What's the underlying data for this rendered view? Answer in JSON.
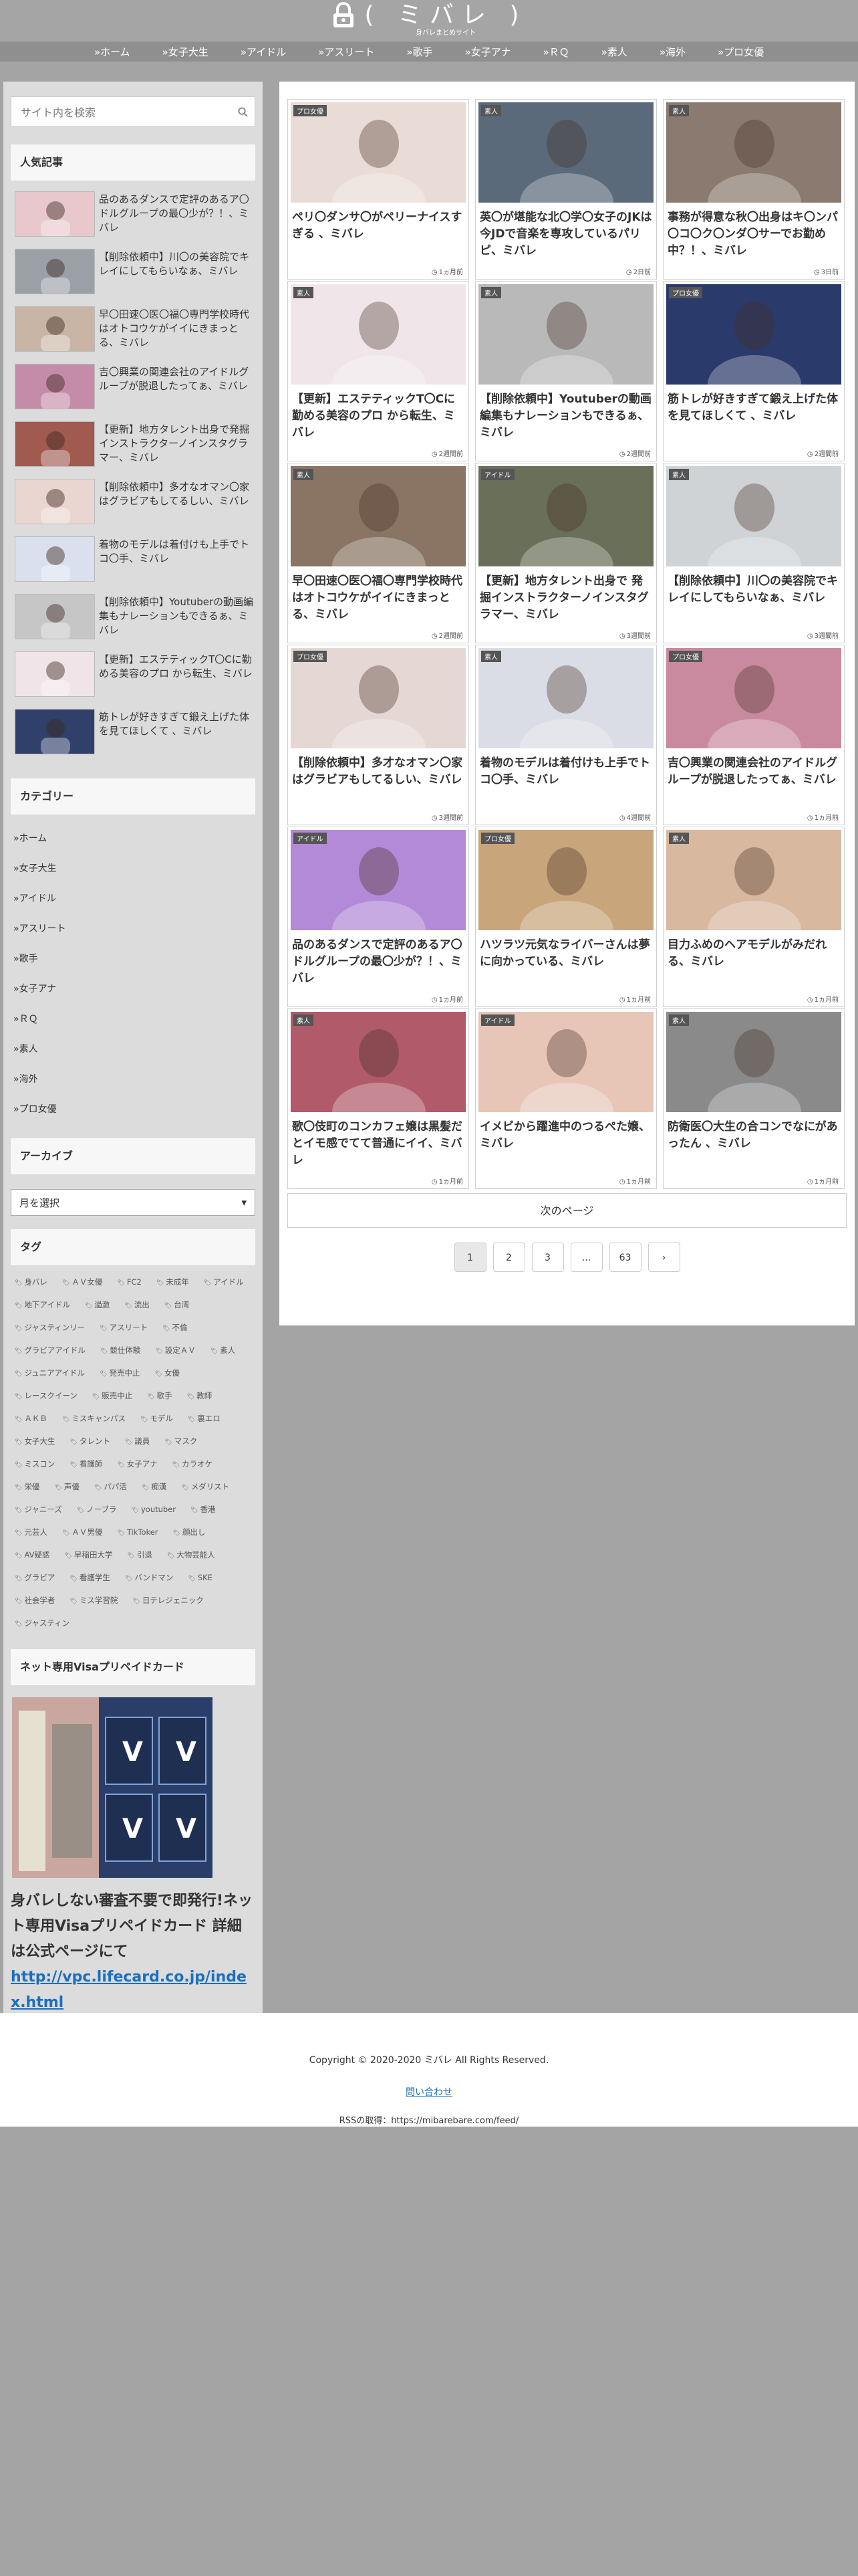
{
  "header": {
    "logo_text": "( ミバレ )",
    "logo_tagline": "身バレまとめサイト"
  },
  "nav": [
    "»ホーム",
    "»女子大生",
    "»アイドル",
    "»アスリート",
    "»歌手",
    "»女子アナ",
    "»ＲＱ",
    "»素人",
    "»海外",
    "»プロ女優"
  ],
  "sidebar": {
    "search_placeholder": "サイト内を検索",
    "popular_title": "人気記事",
    "popular": [
      "品のあるダンスで定評のあるア〇ドルグループの最〇少が？！、ミバレ",
      "【削除依頼中】川〇の美容院でキレイにしてもらいなぁ、ミバレ",
      "早〇田速〇医〇福〇専門学校時代はオトコウケがイイにきまっとる、ミバレ",
      "吉〇興業の関連会社のアイドルグループが脱退したってぁ、ミバレ",
      "【更新】地方タレント出身で発掘インストラクターノインスタグラマー、ミバレ",
      "【削除依頼中】多才なオマン〇家はグラビアもしてるしい、ミバレ",
      "着物のモデルは着付けも上手でトコ〇手、ミバレ",
      "【削除依頼中】Youtuberの動画編集もナレーションもできるぁ、ミバレ",
      "【更新】エステティックT〇Cに勤める美容のプロ から転生、ミバレ",
      "筋トレが好きすぎて鍛え上げた体を見てほしくて 、ミバレ"
    ],
    "category_title": "カテゴリー",
    "categories": [
      "»ホーム",
      "»女子大生",
      "»アイドル",
      "»アスリート",
      "»歌手",
      "»女子アナ",
      "»ＲＱ",
      "»素人",
      "»海外",
      "»プロ女優"
    ],
    "archive_title": "アーカイブ",
    "archive_select": "月を選択",
    "tag_title": "タグ",
    "tags": [
      "身バレ",
      "ＡＶ女優",
      "FC2",
      "未成年",
      "アイドル",
      "地下アイドル",
      "過激",
      "流出",
      "台湾",
      "ジャスティンリー",
      "アスリート",
      "不倫",
      "グラビアアイドル",
      "競仕体験",
      "設定ＡＶ",
      "素人",
      "ジュニアアイドル",
      "発売中止",
      "女優",
      "レースクイーン",
      "販売中止",
      "歌手",
      "教師",
      "ＡＫＢ",
      "ミスキャンパス",
      "モデル",
      "裏エロ",
      "女子大生",
      "タレント",
      "議員",
      "マスク",
      "ミスコン",
      "看護師",
      "女子アナ",
      "カラオケ",
      "栄優",
      "声優",
      "パパ活",
      "痴漢",
      "メダリスト",
      "ジャニーズ",
      "ノーブラ",
      "youtuber",
      "香港",
      "元芸人",
      "ＡＶ男優",
      "TikToker",
      "顔出し",
      "AV疑惑",
      "早稲田大学",
      "引退",
      "大物芸能人",
      "グラビア",
      "看護学生",
      "バンドマン",
      "SKE",
      "社会学者",
      "ミス学習院",
      "日テレジェニック",
      "ジャスティン"
    ],
    "card_title": "ネット専用Visaプリペイドカード",
    "card_heading": "身バレしない審査不要で即発行!ネット専用Visaプリペイドカード 詳細は公式ページにて",
    "card_link": "http://vpc.lifecard.co.jp/index.html"
  },
  "posts": [
    {
      "badge": "プロ女優",
      "title": "ペリ〇ダンサ〇がペリーナイスすぎる 、ミバレ",
      "date": "1ヵ月前",
      "color": "#e9dcd6"
    },
    {
      "badge": "素人",
      "title": "英〇が堪能な北〇学〇女子のJKは今JDで音楽を専攻しているパリピ、ミバレ",
      "date": "2日前",
      "color": "#5a6a7a"
    },
    {
      "badge": "素人",
      "title": "事務が得意な秋〇出身はキ〇ンパ〇コ〇ク〇ンダ〇サーでお勤め中？！、ミバレ",
      "date": "3日前",
      "color": "#8a7a70"
    },
    {
      "badge": "素人",
      "title": "【更新】エステティックT〇Cに勤める美容のプロ から転生、ミバレ",
      "date": "2週間前",
      "color": "#f0e6ea"
    },
    {
      "badge": "素人",
      "title": "【削除依頼中】Youtuberの動画編集もナレーションもできるぁ、ミバレ",
      "date": "2週間前",
      "color": "#b9b9b9"
    },
    {
      "badge": "プロ女優",
      "title": "筋トレが好きすぎて鍛え上げた体を見てほしくて 、ミバレ",
      "date": "2週間前",
      "color": "#2a3a6a"
    },
    {
      "badge": "素人",
      "title": "早〇田速〇医〇福〇専門学校時代はオトコウケがイイにきまっとる、ミバレ",
      "date": "2週間前",
      "color": "#8a7565"
    },
    {
      "badge": "アイドル",
      "title": "【更新】地方タレント出身で 発掘インストラクターノインスタグラマー、ミバレ",
      "date": "3週間前",
      "color": "#6a6f5a"
    },
    {
      "badge": "素人",
      "title": "【削除依頼中】川〇の美容院でキレイにしてもらいなぁ、ミバレ",
      "date": "3週間前",
      "color": "#cfd3d6"
    },
    {
      "badge": "プロ女優",
      "title": "【削除依頼中】多才なオマン〇家はグラビアもしてるしい、ミバレ",
      "date": "3週間前",
      "color": "#e5d8d4"
    },
    {
      "badge": "素人",
      "title": "着物のモデルは着付けも上手でトコ〇手、ミバレ",
      "date": "4週間前",
      "color": "#dadde5"
    },
    {
      "badge": "プロ女優",
      "title": "吉〇興業の関連会社のアイドルグループが脱退したってぁ、ミバレ",
      "date": "1ヵ月前",
      "color": "#c98aa0"
    },
    {
      "badge": "アイドル",
      "title": "品のあるダンスで定評のあるア〇ドルグループの最〇少が？！、ミバレ",
      "date": "1ヵ月前",
      "color": "#b38ad8"
    },
    {
      "badge": "プロ女優",
      "title": "ハツラツ元気なライバーさんは夢に向かっている、ミバレ",
      "date": "1ヵ月前",
      "color": "#c8a57a"
    },
    {
      "badge": "素人",
      "title": "目力ふめのヘアモデルがみだれる、ミバレ",
      "date": "1ヵ月前",
      "color": "#d9b8a0"
    },
    {
      "badge": "素人",
      "title": "歌〇伎町のコンカフェ嬢は黒髪だとイモ感でてて普通にイイ、ミバレ",
      "date": "1ヵ月前",
      "color": "#b05a6a"
    },
    {
      "badge": "アイドル",
      "title": "イメビから躍進中のつるぺた嬢、ミバレ",
      "date": "1ヵ月前",
      "color": "#e7c6b8"
    },
    {
      "badge": "素人",
      "title": "防衛医〇大生の合コンでなにがあったん 、ミバレ",
      "date": "1ヵ月前",
      "color": "#8a8a8a"
    }
  ],
  "next_page": "次のページ",
  "pagination": [
    "1",
    "2",
    "3",
    "...",
    "63",
    "›"
  ],
  "footer": {
    "copyright": "Copyright © 2020-2020 ミバレ All Rights Reserved.",
    "contact": "問い合わせ",
    "rss": "RSSの取得：https://mibarebare.com/feed/"
  }
}
